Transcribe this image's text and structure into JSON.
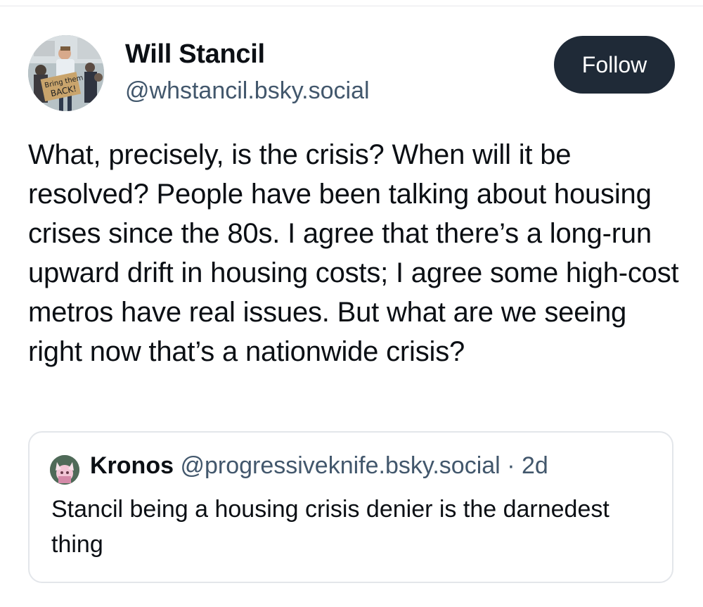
{
  "post": {
    "author": {
      "display_name": "Will Stancil",
      "handle": "@whstancil.bsky.social",
      "avatar_sign_text": "Bring them BACK!"
    },
    "follow_label": "Follow",
    "text": "What, precisely, is the crisis? When will it be resolved? People have been talking about housing crises since the 80s. I agree that there’s a long-run upward drift in housing costs; I agree some high-cost metros have real issues. But what are we seeing right now that’s a nationwide crisis?"
  },
  "quote": {
    "display_name": "Kronos",
    "handle": "@progressiveknife.bsky.social",
    "separator": "·",
    "time": "2d",
    "text": "Stancil being a housing crisis denier is the darnedest thing"
  },
  "colors": {
    "follow_button_bg": "#1f2a37",
    "handle_text": "#42576c",
    "card_border": "#e3e6ea"
  }
}
